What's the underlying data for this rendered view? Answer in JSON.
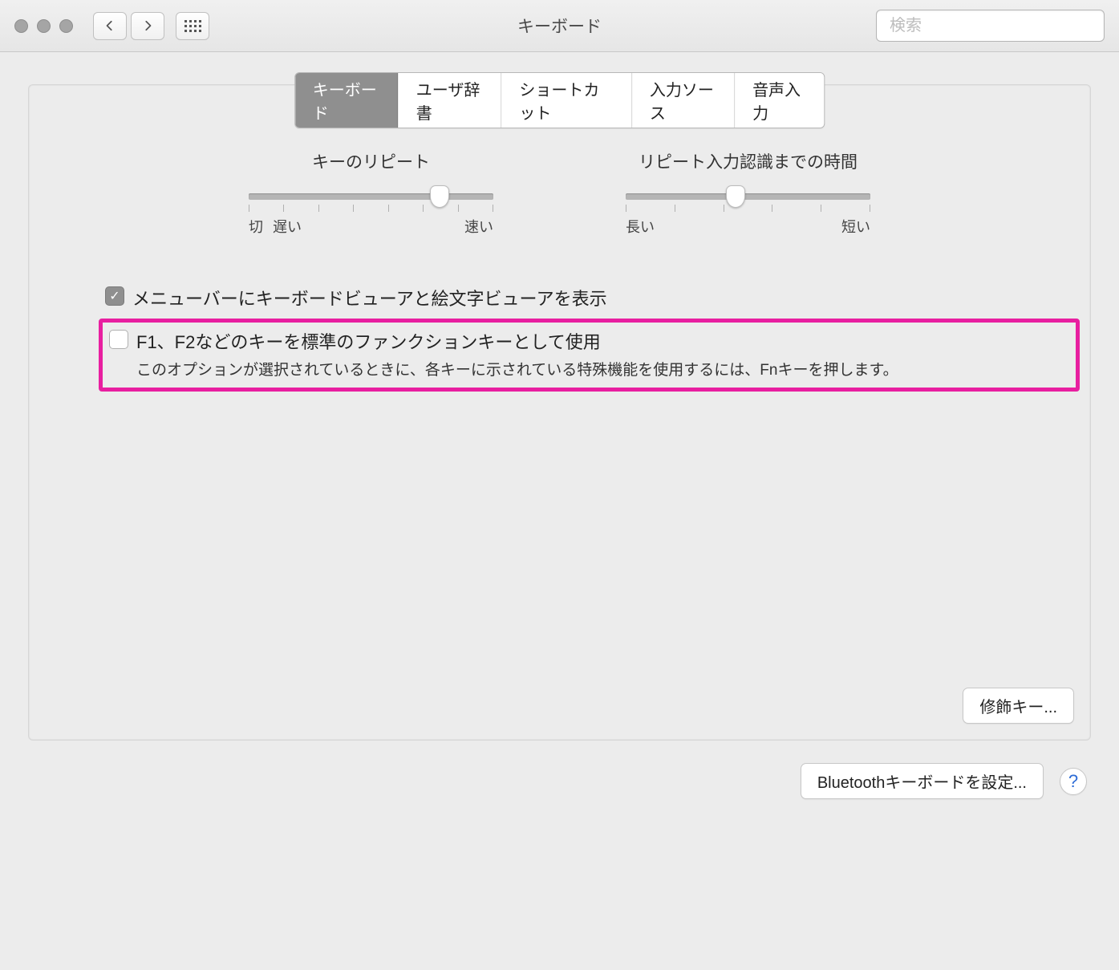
{
  "window": {
    "title": "キーボード",
    "search_placeholder": "検索"
  },
  "tabs": [
    {
      "label": "キーボード",
      "active": true
    },
    {
      "label": "ユーザ辞書",
      "active": false
    },
    {
      "label": "ショートカット",
      "active": false
    },
    {
      "label": "入力ソース",
      "active": false
    },
    {
      "label": "音声入力",
      "active": false
    }
  ],
  "sliders": {
    "key_repeat": {
      "title": "キーのリピート",
      "min_label_a": "切",
      "min_label_b": "遅い",
      "max_label": "速い",
      "ticks": 8,
      "value_percent": 78
    },
    "delay": {
      "title": "リピート入力認識までの時間",
      "min_label": "長い",
      "max_label": "短い",
      "ticks": 6,
      "value_percent": 45
    }
  },
  "checkboxes": {
    "show_viewer": {
      "label": "メニューバーにキーボードビューアと絵文字ビューアを表示",
      "checked": true
    },
    "use_fn": {
      "label": "F1、F2などのキーを標準のファンクションキーとして使用",
      "subtext": "このオプションが選択されているときに、各キーに示されている特殊機能を使用するには、Fnキーを押します。",
      "checked": false
    }
  },
  "buttons": {
    "modifier_keys": "修飾キー...",
    "bluetooth_keyboard": "Bluetoothキーボードを設定...",
    "help": "?"
  },
  "colors": {
    "highlight": "#e81fa0"
  }
}
